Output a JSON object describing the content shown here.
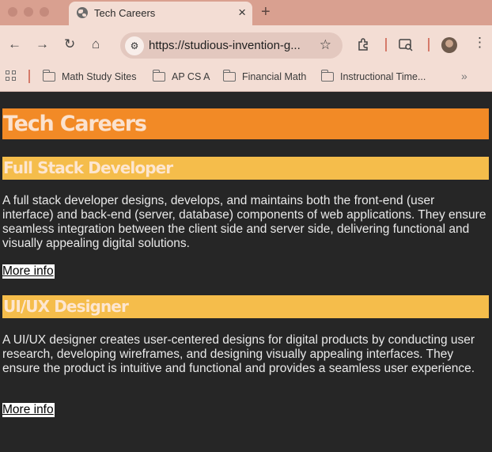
{
  "browser": {
    "tab_title": "Tech Careers",
    "tab_close": "×",
    "new_tab": "+",
    "url": "https://studious-invention-g...",
    "nav": {
      "back": "←",
      "forward": "→",
      "reload": "↻",
      "home": "⌂"
    },
    "menu": "⋮",
    "star": "☆",
    "bookmarks": [
      {
        "label": "Math Study Sites"
      },
      {
        "label": "AP CS A"
      },
      {
        "label": "Financial Math"
      },
      {
        "label": "Instructional Time..."
      }
    ],
    "bookmarks_more": "»"
  },
  "page": {
    "title": "Tech Careers",
    "sections": [
      {
        "heading": "Full Stack Developer",
        "body": "A full stack developer designs, develops, and maintains both the front-end (user interface) and back-end (server, database) components of web applications. They ensure seamless integration between the client side and server side, delivering functional and visually appealing digital solutions.",
        "link": "More info"
      },
      {
        "heading": "UI/UX Designer",
        "body": "A UI/UX designer creates user-centered designs for digital products by conducting user research, developing wireframes, and designing visually appealing interfaces. They ensure the product is intuitive and functional and provides a seamless user experience.",
        "link": "More info"
      }
    ],
    "colors": {
      "background": "#262626",
      "h1_background": "#f28a26",
      "h2_background": "#f5bd4b",
      "text": "#e9e9e9"
    }
  }
}
